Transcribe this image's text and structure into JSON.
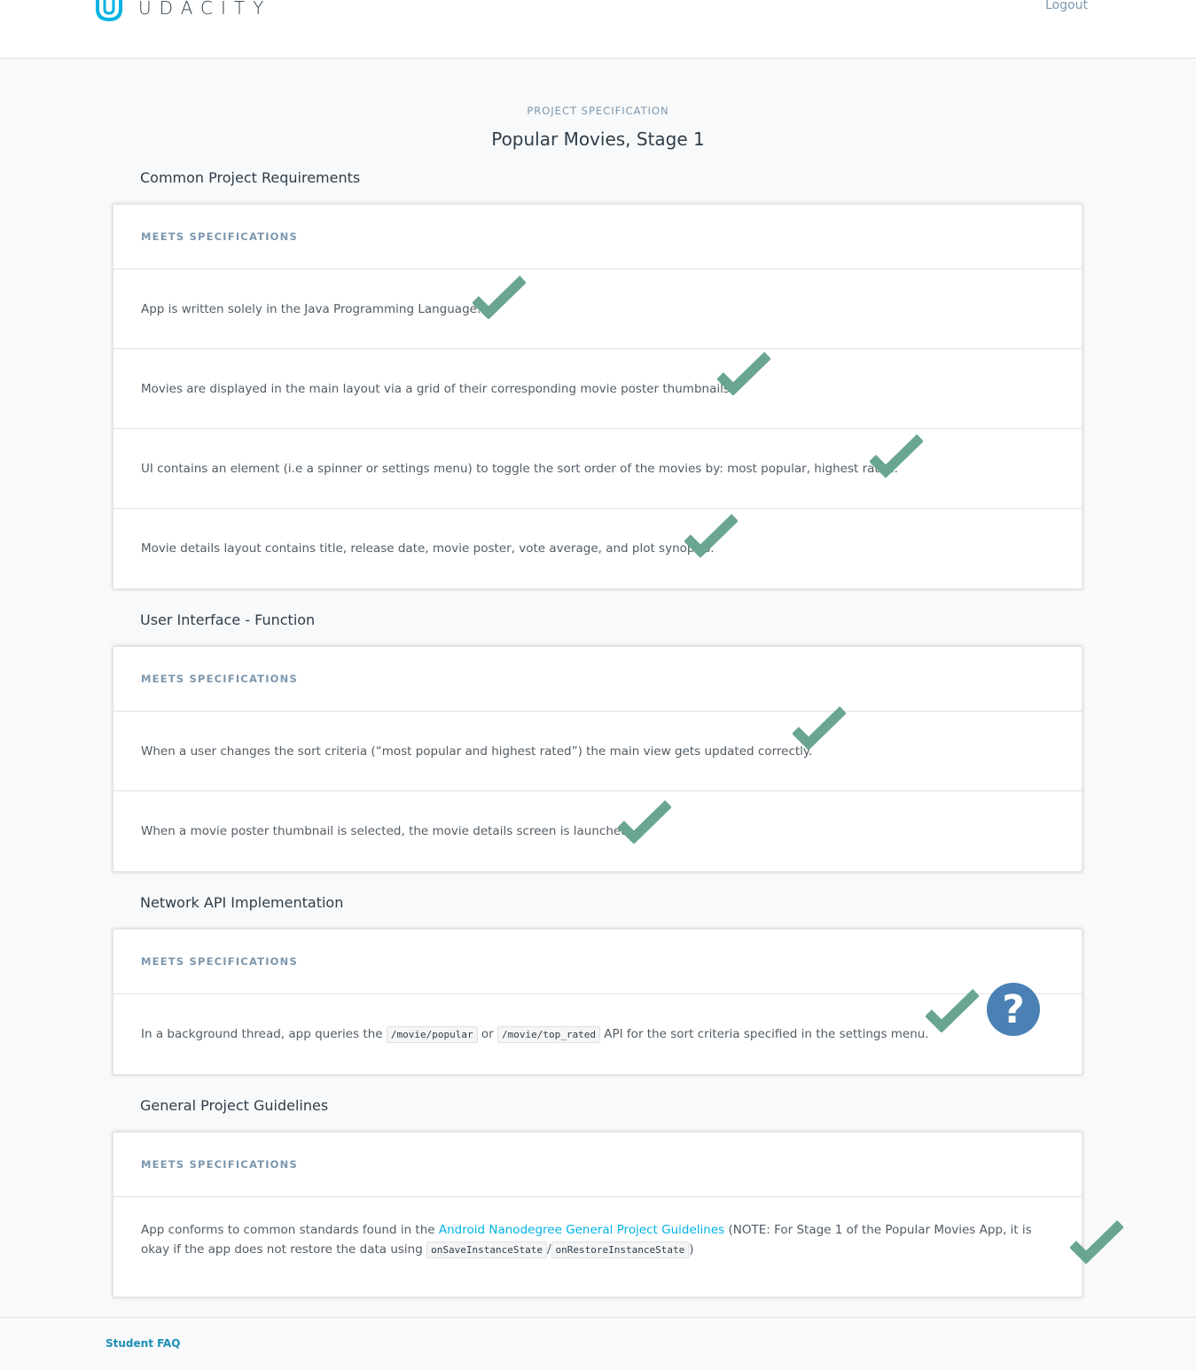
{
  "header": {
    "logo_text": "UDACITY",
    "logout_label": "Logout"
  },
  "page": {
    "eyebrow": "PROJECT SPECIFICATION",
    "title": "Popular Movies, Stage 1"
  },
  "sections": [
    {
      "title": "Common Project Requirements",
      "column_header": "MEETS SPECIFICATIONS",
      "rows": [
        {
          "text": "App is written solely in the Java Programming Language."
        },
        {
          "text": "Movies are displayed in the main layout via a grid of their corresponding movie poster thumbnails."
        },
        {
          "text": "UI contains an element (i.e a spinner or settings menu) to toggle the sort order of the movies by: most popular, highest rated."
        },
        {
          "text": "Movie details layout contains title, release date, movie poster, vote average, and plot synopsis."
        }
      ]
    },
    {
      "title": "User Interface - Function",
      "column_header": "MEETS SPECIFICATIONS",
      "rows": [
        {
          "text": "When a user changes the sort criteria (“most popular and highest rated”) the main view gets updated correctly."
        },
        {
          "text": "When a movie poster thumbnail is selected, the movie details screen is launched."
        }
      ]
    },
    {
      "title": "Network API Implementation",
      "column_header": "MEETS SPECIFICATIONS",
      "rows": [
        {
          "text_before": "In a background thread, app queries the",
          "code_1": "/movie/popular",
          "text_mid": "or",
          "code_2": "/movie/top_rated",
          "text_after": "API for the sort criteria specified in the settings menu."
        }
      ]
    },
    {
      "title": "General Project Guidelines",
      "column_header": "MEETS SPECIFICATIONS",
      "rows": [
        {
          "text_before": "App conforms to common standards found in the",
          "link": "Android Nanodegree General Project Guidelines",
          "text_mid": "(NOTE: For Stage 1 of the Popular Movies App, it is okay if the app does not restore the data using",
          "code_1": "onSaveInstanceState",
          "separator": "/",
          "code_2": "onRestoreInstanceState",
          "text_after": ")"
        }
      ]
    }
  ],
  "icons": {
    "check": "check-icon",
    "help": "question-icon",
    "help_glyph": "?"
  },
  "colors": {
    "check": "#6aa68f",
    "help": "#4a80b4",
    "link": "#02b3e4",
    "logo": "#02b3e4"
  },
  "footer": {
    "faq_label": "Student FAQ"
  }
}
